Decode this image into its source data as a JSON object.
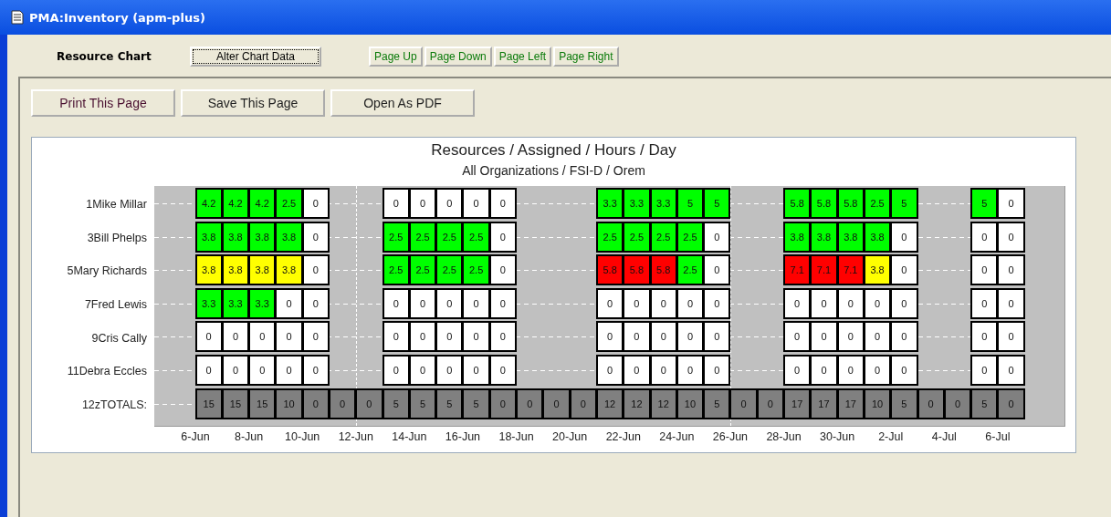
{
  "window": {
    "title": "PMA:Inventory (apm-plus)"
  },
  "header": {
    "label": "Resource Chart",
    "alter_button": "Alter Chart Data",
    "nav_buttons": [
      "Page Up",
      "Page Down",
      "Page Left",
      "Page Right"
    ]
  },
  "actions": [
    "Print This Page",
    "Save This Page",
    "Open As PDF"
  ],
  "chart": {
    "title": "Resources / Assigned / Hours / Day",
    "subtitle": "All Organizations / FSI-D / Orem",
    "x_labels": [
      "6-Jun",
      "8-Jun",
      "10-Jun",
      "12-Jun",
      "14-Jun",
      "16-Jun",
      "18-Jun",
      "20-Jun",
      "22-Jun",
      "24-Jun",
      "26-Jun",
      "28-Jun",
      "30-Jun",
      "2-Jul",
      "4-Jul",
      "6-Jul"
    ],
    "rows": [
      {
        "label": "1Mike Millar",
        "cells": [
          {
            "value": "4.2",
            "color": "#00ff00"
          },
          {
            "value": "4.2",
            "color": "#00ff00"
          },
          {
            "value": "4.2",
            "color": "#00ff00"
          },
          {
            "value": "2.5",
            "color": "#00ff00"
          },
          {
            "value": "0",
            "color": "#ffffff"
          },
          null,
          null,
          {
            "value": "0",
            "color": "#ffffff"
          },
          {
            "value": "0",
            "color": "#ffffff"
          },
          {
            "value": "0",
            "color": "#ffffff"
          },
          {
            "value": "0",
            "color": "#ffffff"
          },
          {
            "value": "0",
            "color": "#ffffff"
          },
          null,
          null,
          null,
          {
            "value": "3.3",
            "color": "#00ff00"
          },
          {
            "value": "3.3",
            "color": "#00ff00"
          },
          {
            "value": "3.3",
            "color": "#00ff00"
          },
          {
            "value": "5",
            "color": "#00ff00"
          },
          {
            "value": "5",
            "color": "#00ff00"
          },
          null,
          null,
          {
            "value": "5.8",
            "color": "#00ff00"
          },
          {
            "value": "5.8",
            "color": "#00ff00"
          },
          {
            "value": "5.8",
            "color": "#00ff00"
          },
          {
            "value": "2.5",
            "color": "#00ff00"
          },
          {
            "value": "5",
            "color": "#00ff00"
          },
          null,
          null,
          {
            "value": "5",
            "color": "#00ff00"
          },
          {
            "value": "0",
            "color": "#ffffff"
          }
        ]
      },
      {
        "label": "3Bill Phelps",
        "cells": [
          {
            "value": "3.8",
            "color": "#00ff00"
          },
          {
            "value": "3.8",
            "color": "#00ff00"
          },
          {
            "value": "3.8",
            "color": "#00ff00"
          },
          {
            "value": "3.8",
            "color": "#00ff00"
          },
          {
            "value": "0",
            "color": "#ffffff"
          },
          null,
          null,
          {
            "value": "2.5",
            "color": "#00ff00"
          },
          {
            "value": "2.5",
            "color": "#00ff00"
          },
          {
            "value": "2.5",
            "color": "#00ff00"
          },
          {
            "value": "2.5",
            "color": "#00ff00"
          },
          {
            "value": "0",
            "color": "#ffffff"
          },
          null,
          null,
          null,
          {
            "value": "2.5",
            "color": "#00ff00"
          },
          {
            "value": "2.5",
            "color": "#00ff00"
          },
          {
            "value": "2.5",
            "color": "#00ff00"
          },
          {
            "value": "2.5",
            "color": "#00ff00"
          },
          {
            "value": "0",
            "color": "#ffffff"
          },
          null,
          null,
          {
            "value": "3.8",
            "color": "#00ff00"
          },
          {
            "value": "3.8",
            "color": "#00ff00"
          },
          {
            "value": "3.8",
            "color": "#00ff00"
          },
          {
            "value": "3.8",
            "color": "#00ff00"
          },
          {
            "value": "0",
            "color": "#ffffff"
          },
          null,
          null,
          {
            "value": "0",
            "color": "#ffffff"
          },
          {
            "value": "0",
            "color": "#ffffff"
          }
        ]
      },
      {
        "label": "5Mary Richards",
        "cells": [
          {
            "value": "3.8",
            "color": "#ffff00"
          },
          {
            "value": "3.8",
            "color": "#ffff00"
          },
          {
            "value": "3.8",
            "color": "#ffff00"
          },
          {
            "value": "3.8",
            "color": "#ffff00"
          },
          {
            "value": "0",
            "color": "#ffffff"
          },
          null,
          null,
          {
            "value": "2.5",
            "color": "#00ff00"
          },
          {
            "value": "2.5",
            "color": "#00ff00"
          },
          {
            "value": "2.5",
            "color": "#00ff00"
          },
          {
            "value": "2.5",
            "color": "#00ff00"
          },
          {
            "value": "0",
            "color": "#ffffff"
          },
          null,
          null,
          null,
          {
            "value": "5.8",
            "color": "#ff0000"
          },
          {
            "value": "5.8",
            "color": "#ff0000"
          },
          {
            "value": "5.8",
            "color": "#ff0000"
          },
          {
            "value": "2.5",
            "color": "#00ff00"
          },
          {
            "value": "0",
            "color": "#ffffff"
          },
          null,
          null,
          {
            "value": "7.1",
            "color": "#ff0000"
          },
          {
            "value": "7.1",
            "color": "#ff0000"
          },
          {
            "value": "7.1",
            "color": "#ff0000"
          },
          {
            "value": "3.8",
            "color": "#ffff00"
          },
          {
            "value": "0",
            "color": "#ffffff"
          },
          null,
          null,
          {
            "value": "0",
            "color": "#ffffff"
          },
          {
            "value": "0",
            "color": "#ffffff"
          }
        ]
      },
      {
        "label": "7Fred Lewis",
        "cells": [
          {
            "value": "3.3",
            "color": "#00ff00"
          },
          {
            "value": "3.3",
            "color": "#00ff00"
          },
          {
            "value": "3.3",
            "color": "#00ff00"
          },
          {
            "value": "0",
            "color": "#ffffff"
          },
          {
            "value": "0",
            "color": "#ffffff"
          },
          null,
          null,
          {
            "value": "0",
            "color": "#ffffff"
          },
          {
            "value": "0",
            "color": "#ffffff"
          },
          {
            "value": "0",
            "color": "#ffffff"
          },
          {
            "value": "0",
            "color": "#ffffff"
          },
          {
            "value": "0",
            "color": "#ffffff"
          },
          null,
          null,
          null,
          {
            "value": "0",
            "color": "#ffffff"
          },
          {
            "value": "0",
            "color": "#ffffff"
          },
          {
            "value": "0",
            "color": "#ffffff"
          },
          {
            "value": "0",
            "color": "#ffffff"
          },
          {
            "value": "0",
            "color": "#ffffff"
          },
          null,
          null,
          {
            "value": "0",
            "color": "#ffffff"
          },
          {
            "value": "0",
            "color": "#ffffff"
          },
          {
            "value": "0",
            "color": "#ffffff"
          },
          {
            "value": "0",
            "color": "#ffffff"
          },
          {
            "value": "0",
            "color": "#ffffff"
          },
          null,
          null,
          {
            "value": "0",
            "color": "#ffffff"
          },
          {
            "value": "0",
            "color": "#ffffff"
          }
        ]
      },
      {
        "label": "9Cris Cally",
        "cells": [
          {
            "value": "0",
            "color": "#ffffff"
          },
          {
            "value": "0",
            "color": "#ffffff"
          },
          {
            "value": "0",
            "color": "#ffffff"
          },
          {
            "value": "0",
            "color": "#ffffff"
          },
          {
            "value": "0",
            "color": "#ffffff"
          },
          null,
          null,
          {
            "value": "0",
            "color": "#ffffff"
          },
          {
            "value": "0",
            "color": "#ffffff"
          },
          {
            "value": "0",
            "color": "#ffffff"
          },
          {
            "value": "0",
            "color": "#ffffff"
          },
          {
            "value": "0",
            "color": "#ffffff"
          },
          null,
          null,
          null,
          {
            "value": "0",
            "color": "#ffffff"
          },
          {
            "value": "0",
            "color": "#ffffff"
          },
          {
            "value": "0",
            "color": "#ffffff"
          },
          {
            "value": "0",
            "color": "#ffffff"
          },
          {
            "value": "0",
            "color": "#ffffff"
          },
          null,
          null,
          {
            "value": "0",
            "color": "#ffffff"
          },
          {
            "value": "0",
            "color": "#ffffff"
          },
          {
            "value": "0",
            "color": "#ffffff"
          },
          {
            "value": "0",
            "color": "#ffffff"
          },
          {
            "value": "0",
            "color": "#ffffff"
          },
          null,
          null,
          {
            "value": "0",
            "color": "#ffffff"
          },
          {
            "value": "0",
            "color": "#ffffff"
          }
        ]
      },
      {
        "label": "11Debra Eccles",
        "cells": [
          {
            "value": "0",
            "color": "#ffffff"
          },
          {
            "value": "0",
            "color": "#ffffff"
          },
          {
            "value": "0",
            "color": "#ffffff"
          },
          {
            "value": "0",
            "color": "#ffffff"
          },
          {
            "value": "0",
            "color": "#ffffff"
          },
          null,
          null,
          {
            "value": "0",
            "color": "#ffffff"
          },
          {
            "value": "0",
            "color": "#ffffff"
          },
          {
            "value": "0",
            "color": "#ffffff"
          },
          {
            "value": "0",
            "color": "#ffffff"
          },
          {
            "value": "0",
            "color": "#ffffff"
          },
          null,
          null,
          null,
          {
            "value": "0",
            "color": "#ffffff"
          },
          {
            "value": "0",
            "color": "#ffffff"
          },
          {
            "value": "0",
            "color": "#ffffff"
          },
          {
            "value": "0",
            "color": "#ffffff"
          },
          {
            "value": "0",
            "color": "#ffffff"
          },
          null,
          null,
          {
            "value": "0",
            "color": "#ffffff"
          },
          {
            "value": "0",
            "color": "#ffffff"
          },
          {
            "value": "0",
            "color": "#ffffff"
          },
          {
            "value": "0",
            "color": "#ffffff"
          },
          {
            "value": "0",
            "color": "#ffffff"
          },
          null,
          null,
          {
            "value": "0",
            "color": "#ffffff"
          },
          {
            "value": "0",
            "color": "#ffffff"
          }
        ]
      },
      {
        "label": "12zTOTALS:",
        "cells": [
          {
            "value": "15",
            "color": "#808080"
          },
          {
            "value": "15",
            "color": "#808080"
          },
          {
            "value": "15",
            "color": "#808080"
          },
          {
            "value": "10",
            "color": "#808080"
          },
          {
            "value": "0",
            "color": "#808080"
          },
          {
            "value": "0",
            "color": "#808080"
          },
          {
            "value": "0",
            "color": "#808080"
          },
          {
            "value": "5",
            "color": "#808080"
          },
          {
            "value": "5",
            "color": "#808080"
          },
          {
            "value": "5",
            "color": "#808080"
          },
          {
            "value": "5",
            "color": "#808080"
          },
          {
            "value": "0",
            "color": "#808080"
          },
          {
            "value": "0",
            "color": "#808080"
          },
          {
            "value": "0",
            "color": "#808080"
          },
          {
            "value": "0",
            "color": "#808080"
          },
          {
            "value": "12",
            "color": "#808080"
          },
          {
            "value": "12",
            "color": "#808080"
          },
          {
            "value": "12",
            "color": "#808080"
          },
          {
            "value": "10",
            "color": "#808080"
          },
          {
            "value": "5",
            "color": "#808080"
          },
          {
            "value": "0",
            "color": "#808080"
          },
          {
            "value": "0",
            "color": "#808080"
          },
          {
            "value": "17",
            "color": "#808080"
          },
          {
            "value": "17",
            "color": "#808080"
          },
          {
            "value": "17",
            "color": "#808080"
          },
          {
            "value": "10",
            "color": "#808080"
          },
          {
            "value": "5",
            "color": "#808080"
          },
          {
            "value": "0",
            "color": "#808080"
          },
          {
            "value": "0",
            "color": "#808080"
          },
          {
            "value": "5",
            "color": "#808080"
          },
          {
            "value": "0",
            "color": "#808080"
          }
        ]
      }
    ]
  }
}
